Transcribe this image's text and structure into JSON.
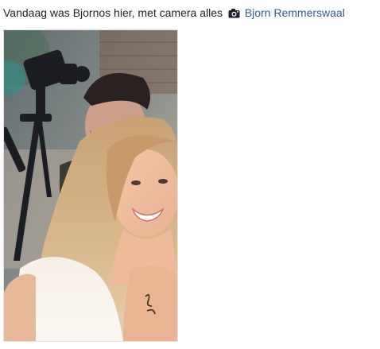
{
  "post": {
    "text": "Vandaag was Bjornos hier, met camera alles",
    "activity_icon": "camera-icon",
    "tagged_person": "Bjorn Remmerswaal",
    "link_color": "#365899"
  },
  "photo": {
    "kind": "selfie photo"
  }
}
